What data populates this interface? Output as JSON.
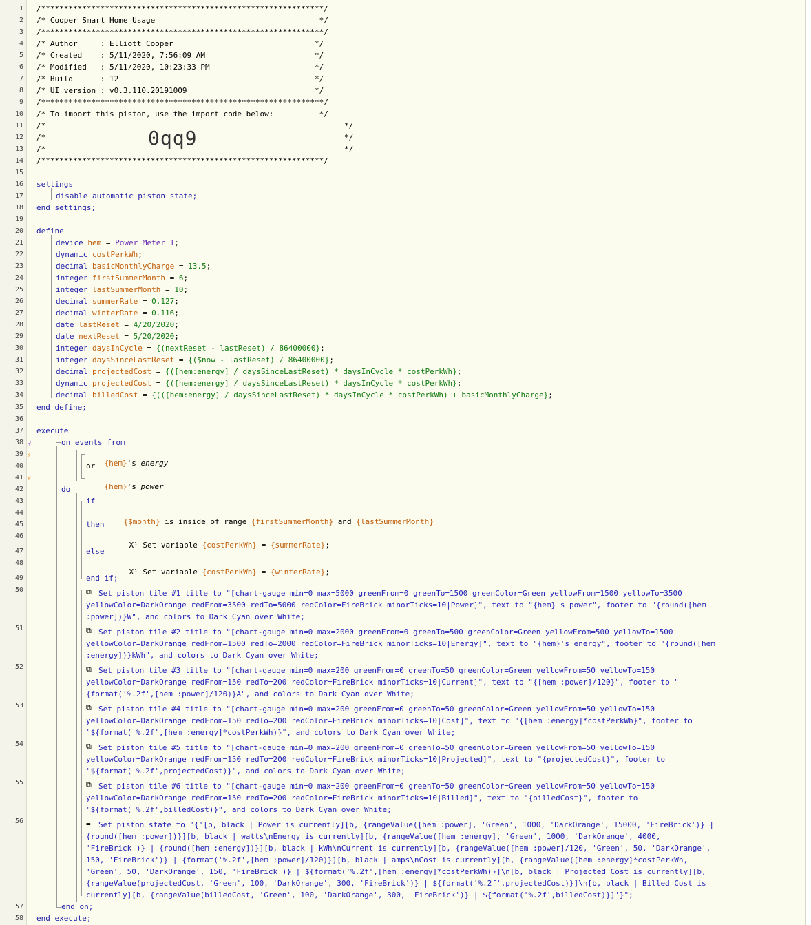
{
  "colors": {
    "keyword": "#1f1fa8",
    "type": "#127a12",
    "variable": "#c0600e",
    "string": "#1f1fb8",
    "device": "#6a2fb0",
    "comment": "#000000",
    "gutter_mark": "#f08a1e",
    "branch_mark": "#9a4fd0"
  },
  "icons": {
    "trigger": "lightning-icon",
    "fork": "fork-icon",
    "set_variable": "variable-x-icon",
    "set_tile": "tile-icon",
    "set_state": "lines-icon"
  },
  "lines": {
    "l1": "/**************************************************************/",
    "l2": "/* Cooper Smart Home Usage                                    */",
    "l3": "/**************************************************************/",
    "l4": "/* Author     : Elliott Cooper                               */",
    "l5": "/* Created    : 5/11/2020, 7:56:09 AM                        */",
    "l6": "/* Modified   : 5/11/2020, 10:23:33 PM                       */",
    "l7": "/* Build      : 12                                           */",
    "l8": "/* UI version : v0.3.110.20191009                            */",
    "l9": "/**************************************************************/",
    "l10": "/* To import this piston, use the import code below:          */",
    "l11a": "/*",
    "l11b": "*/",
    "l12a": "/*",
    "l12code": "0qq9",
    "l12b": "*/",
    "l13a": "/*",
    "l13b": "*/",
    "l14": "/**************************************************************/",
    "settings": "settings",
    "disable": "disable automatic piston state;",
    "endsettings": "end settings;",
    "define": "define",
    "enddefine": "end define;",
    "execute": "execute",
    "onevents": "on events from",
    "hem_energy_var": "{hem}",
    "hem_energy_s": "'s ",
    "hem_energy_attr": "energy",
    "or": "or",
    "hem_power_var": "{hem}",
    "hem_power_s": "'s ",
    "hem_power_attr": "power",
    "do": "do",
    "if": "if",
    "cond_month": "{$month}",
    "cond_inside": " is inside of range ",
    "cond_first": "{firstSummerMonth}",
    "cond_and": " and ",
    "cond_last": "{lastSummerMonth}",
    "then": "then",
    "x1": "X¹",
    "setvar": " Set variable ",
    "costvar": "{costPerkWh}",
    "eq": " = ",
    "summer": "{summerRate}",
    "semi": ";",
    "else": "else",
    "winter": "{winterRate}",
    "endif": "end if;",
    "endon": "end on;",
    "endexecute": "end execute;"
  },
  "defines": [
    {
      "kw": "device",
      "name": "hem",
      "eq": " = ",
      "val": "Power Meter 1",
      "valcls": "p",
      "end": ";"
    },
    {
      "kw": "dynamic",
      "name": "costPerkWh",
      "eq": "",
      "val": "",
      "valcls": "t",
      "end": ";"
    },
    {
      "kw": "decimal",
      "name": "basicMonthlyCharge",
      "eq": " = ",
      "val": "13.5",
      "valcls": "t",
      "end": ";"
    },
    {
      "kw": "integer",
      "name": "firstSummerMonth",
      "eq": " = ",
      "val": "6",
      "valcls": "t",
      "end": ";"
    },
    {
      "kw": "integer",
      "name": "lastSummerMonth",
      "eq": " = ",
      "val": "10",
      "valcls": "t",
      "end": ";"
    },
    {
      "kw": "decimal",
      "name": "summerRate",
      "eq": " = ",
      "val": "0.127",
      "valcls": "t",
      "end": ";"
    },
    {
      "kw": "decimal",
      "name": "winterRate",
      "eq": " = ",
      "val": "0.116",
      "valcls": "t",
      "end": ";"
    },
    {
      "kw": "date",
      "name": "lastReset",
      "eq": " = ",
      "val": "4/20/2020",
      "valcls": "t",
      "end": ";"
    },
    {
      "kw": "date",
      "name": "nextReset",
      "eq": " = ",
      "val": "5/20/2020",
      "valcls": "t",
      "end": ";"
    },
    {
      "kw": "integer",
      "name": "daysInCycle",
      "eq": " = ",
      "val": "{(nextReset - lastReset) / 86400000}",
      "valcls": "t",
      "end": ";"
    },
    {
      "kw": "integer",
      "name": "daysSinceLastReset",
      "eq": " = ",
      "val": "{($now - lastReset) / 86400000}",
      "valcls": "t",
      "end": ";"
    },
    {
      "kw": "decimal",
      "name": "projectedCost",
      "eq": " = ",
      "val": "{([hem:energy] / daysSinceLastReset) * daysInCycle * costPerkWh}",
      "valcls": "t",
      "end": ";"
    },
    {
      "kw": "dynamic",
      "name": "projectedCost",
      "eq": " = ",
      "val": "{([hem:energy] / daysSinceLastReset) * daysInCycle * costPerkWh}",
      "valcls": "t",
      "end": ";"
    },
    {
      "kw": "decimal",
      "name": "billedCost",
      "eq": " = ",
      "val": "{(([hem:energy] / daysSinceLastReset) * daysInCycle * costPerkWh) + basicMonthlyCharge}",
      "valcls": "t",
      "end": ";"
    }
  ],
  "tiles": [
    {
      "r1": "Set piston tile #1 title to \"[chart-gauge min=0 max=5000 greenFrom=0 greenTo=1500 greenColor=Green yellowFrom=1500 yellowTo=3500",
      "r2": "yellowColor=DarkOrange redFrom=3500 redTo=5000 redColor=FireBrick minorTicks=10|Power]\", text to \"{hem}'s power\", footer to \"{round([hem",
      "r3": ":power])}W\", and colors to Dark Cyan over White;"
    },
    {
      "r1": "Set piston tile #2 title to \"[chart-gauge min=0 max=2000 greenFrom=0 greenTo=500 greenColor=Green yellowFrom=500 yellowTo=1500",
      "r2": "yellowColor=DarkOrange redFrom=1500 redTo=2000 redColor=FireBrick minorTicks=10|Energy]\", text to \"{hem}'s energy\", footer to \"{round([hem",
      "r3": ":energy])}kWh\", and colors to Dark Cyan over White;"
    },
    {
      "r1": "Set piston tile #3 title to \"[chart-gauge min=0 max=200 greenFrom=0 greenTo=50 greenColor=Green yellowFrom=50 yellowTo=150",
      "r2": "yellowColor=DarkOrange redFrom=150 redTo=200 redColor=FireBrick minorTicks=10|Current]\", text to \"{[hem :power]/120}\", footer to \"",
      "r3": "{format('%.2f',[hem :power]/120)}A\", and colors to Dark Cyan over White;"
    },
    {
      "r1": "Set piston tile #4 title to \"[chart-gauge min=0 max=200 greenFrom=0 greenTo=50 greenColor=Green yellowFrom=50 yellowTo=150",
      "r2": "yellowColor=DarkOrange redFrom=150 redTo=200 redColor=FireBrick minorTicks=10|Cost]\", text to \"{[hem :energy]*costPerkWh}\", footer to",
      "r3": "\"${format('%.2f',[hem :energy]*costPerkWh)}\", and colors to Dark Cyan over White;"
    },
    {
      "r1": "Set piston tile #5 title to \"[chart-gauge min=0 max=200 greenFrom=0 greenTo=50 greenColor=Green yellowFrom=50 yellowTo=150",
      "r2": "yellowColor=DarkOrange redFrom=150 redTo=200 redColor=FireBrick minorTicks=10|Projected]\", text to \"{projectedCost}\", footer to",
      "r3": "\"${format('%.2f',projectedCost)}\", and colors to Dark Cyan over White;"
    },
    {
      "r1": "Set piston tile #6 title to \"[chart-gauge min=0 max=200 greenFrom=0 greenTo=50 greenColor=Green yellowFrom=50 yellowTo=150",
      "r2": "yellowColor=DarkOrange redFrom=150 redTo=200 redColor=FireBrick minorTicks=10|Billed]\", text to \"{billedCost}\", footer to",
      "r3": "\"${format('%.2f',billedCost)}\", and colors to Dark Cyan over White;"
    }
  ],
  "state": [
    "Set piston state to \"{'[b, black | Power is currently][b, {rangeValue([hem :power], 'Green', 1000, 'DarkOrange', 15000, 'FireBrick')} |",
    "{round([hem :power])}][b, black | watts\\nEnergy is currently][b, {rangeValue([hem :energy], 'Green', 1000, 'DarkOrange', 4000,",
    "'FireBrick')} | {round([hem :energy])}][b, black | kWh\\nCurrent is currently][b, {rangeValue([hem :power]/120, 'Green', 50, 'DarkOrange',",
    "150, 'FireBrick')} | {format('%.2f',[hem :power]/120)}][b, black | amps\\nCost is currently][b, {rangeValue([hem :energy]*costPerkWh,",
    "'Green', 50, 'DarkOrange', 150, 'FireBrick')} | ${format('%.2f',[hem :energy]*costPerkWh)}]\\n[b, black | Projected Cost is currently][b,",
    "{rangeValue(projectedCost, 'Green', 100, 'DarkOrange', 300, 'FireBrick')} | ${format('%.2f',projectedCost)}]\\n[b, black | Billed Cost is",
    "currently][b, {rangeValue(billedCost, 'Green', 100, 'DarkOrange', 300, 'FireBrick')} | ${format('%.2f',billedCost)}]'}\";"
  ],
  "gutter": {
    "numbers": [
      "1",
      "2",
      "3",
      "4",
      "5",
      "6",
      "7",
      "8",
      "9",
      "10",
      "11",
      "12",
      "13",
      "14",
      "15",
      "16",
      "17",
      "18",
      "19",
      "20",
      "21",
      "22",
      "23",
      "24",
      "25",
      "26",
      "27",
      "28",
      "29",
      "30",
      "31",
      "32",
      "33",
      "34",
      "35",
      "36",
      "37",
      "38",
      "39",
      "40",
      "41",
      "42",
      "43",
      "44",
      "45",
      "46",
      "47",
      "48",
      "49",
      "50",
      "51",
      "52",
      "53",
      "54",
      "55",
      "56",
      "57",
      "58"
    ]
  }
}
